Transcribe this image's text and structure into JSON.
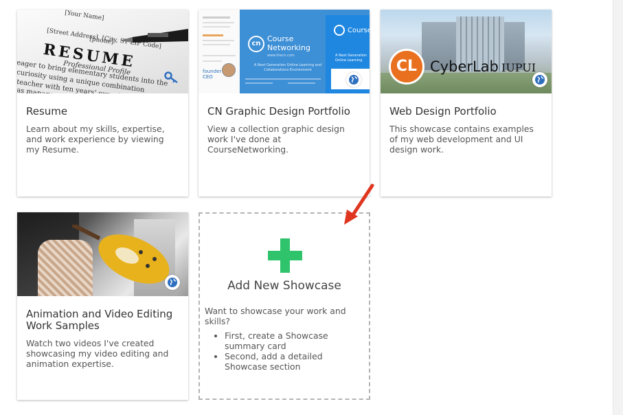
{
  "cards": [
    {
      "title": "Resume",
      "description": "Learn about my skills, expertise, and work experience by viewing my Resume.",
      "thumb_text": {
        "name": "[Your Name]",
        "street": "[Street Address], [City, ST ZIP Code]",
        "phone": "[phone]",
        "heading": "RESUME",
        "subheading": "Professional Profile",
        "body1": "eager to bring elementary students into the",
        "body2": "curiosity using a unique combination",
        "body3": "teacher with ten years' experience",
        "body4": "as manages"
      }
    },
    {
      "title": "CN Graphic Design Portfolio",
      "description": "View a collection graphic design work I've done at CourseNetworking.",
      "thumb_text": {
        "brand_line1": "Course",
        "brand_line2": "Networking",
        "url": "www.thecn.com",
        "tagline": "A Next Generation Online Learning and Collaborations Environment",
        "founder": "founder CEO",
        "panel_brand": "Course",
        "panel_tag": "A Next Generation Online Learning",
        "logo": "cn"
      }
    },
    {
      "title": "Web Design Portfolio",
      "description": "This showcase contains examples of my web development and UI design work.",
      "thumb_text": {
        "logo": "CL",
        "brand": "CyberLab",
        "sep": "·",
        "org": "IUPUI"
      }
    },
    {
      "title": "Animation and Video Editing Work Samples",
      "description": "Watch two videos I've created showcasing my video editing and animation expertise."
    }
  ],
  "add_new": {
    "title": "Add New Showcase",
    "subtitle": "Want to showcase your work and skills?",
    "steps": [
      "First, create a Showcase summary card",
      "Second, add a detailed Showcase section"
    ]
  },
  "colors": {
    "plus": "#2fc36b",
    "arrow": "#e0351f",
    "globe": "#2f6fbf",
    "cn_blue": "#3d8fd6"
  },
  "icons": [
    "globe-icon",
    "plus-icon",
    "key-icon",
    "arrow-annotation"
  ]
}
